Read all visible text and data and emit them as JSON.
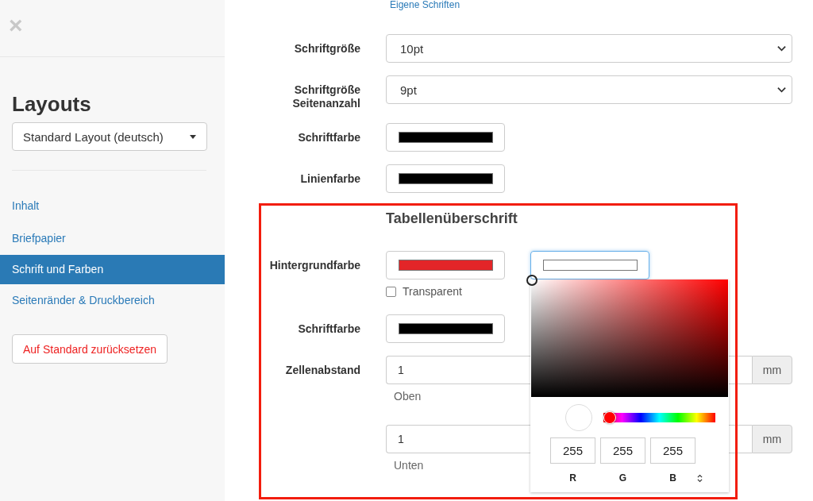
{
  "sidebar": {
    "close": "×",
    "title": "Layouts",
    "layout_select": "Standard Layout (deutsch)",
    "items": [
      {
        "label": "Inhalt",
        "selected": false
      },
      {
        "label": "Briefpapier",
        "selected": false
      },
      {
        "label": "Schrift und Farben",
        "selected": true
      },
      {
        "label": "Seitenränder & Druckbereich",
        "selected": false
      }
    ],
    "reset_button": "Auf Standard zurücksetzen"
  },
  "main": {
    "link": "Eigene Schriften",
    "rows": [
      {
        "kind": "select",
        "label": "Schriftgröße",
        "value": "10pt"
      },
      {
        "kind": "select",
        "label": "Schriftgröße Seitenanzahl",
        "value": "9pt"
      },
      {
        "kind": "color",
        "label": "Schriftfarbe",
        "color": "#000000"
      },
      {
        "kind": "color",
        "label": "Linienfarbe",
        "color": "#000000"
      },
      {
        "kind": "heading",
        "label": "Tabellenüberschrift"
      },
      {
        "kind": "color",
        "label": "Hintergrundfarbe",
        "color": "#e32528",
        "picker_field": {
          "color": "#ffffff",
          "focused": true
        },
        "checkbox": {
          "label": "Transparent",
          "checked": false
        }
      },
      {
        "kind": "color",
        "label": "Schriftfarbe",
        "color": "#000000"
      },
      {
        "kind": "number",
        "label": "Zellenabstand",
        "value": "1",
        "unit": "mm",
        "help": "Oben"
      },
      {
        "kind": "number",
        "value": "1",
        "unit": "mm",
        "help": "Unten"
      }
    ]
  },
  "color_picker": {
    "hue": {
      "level": 0
    },
    "channels": [
      {
        "value": "255",
        "label": "R"
      },
      {
        "value": "255",
        "label": "G"
      },
      {
        "value": "255",
        "label": "B"
      }
    ]
  }
}
